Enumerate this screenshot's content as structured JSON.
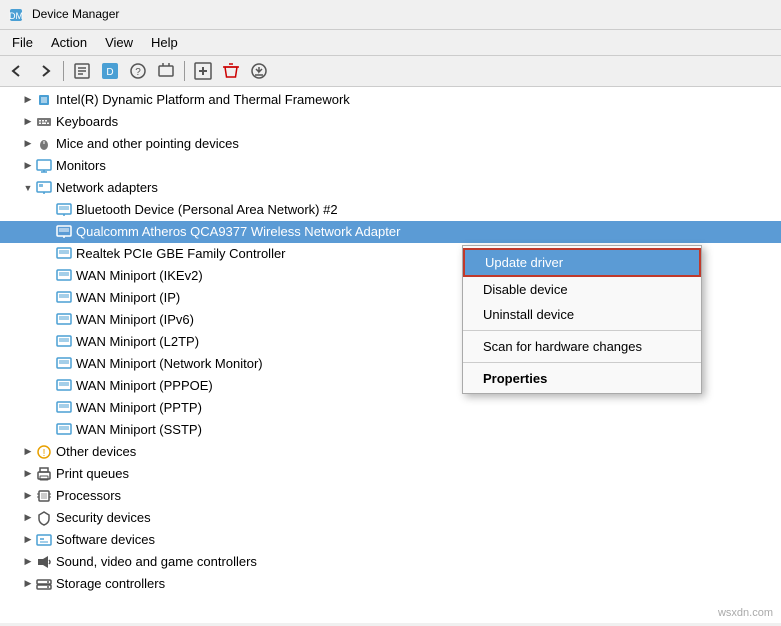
{
  "titleBar": {
    "title": "Device Manager"
  },
  "menuBar": {
    "items": [
      "File",
      "Action",
      "View",
      "Help"
    ]
  },
  "toolbar": {
    "buttons": [
      "back",
      "forward",
      "properties",
      "update-driver",
      "help",
      "scan",
      "add-hardware",
      "remove-driver",
      "download"
    ]
  },
  "tree": {
    "items": [
      {
        "id": "intel",
        "label": "Intel(R) Dynamic Platform and Thermal Framework",
        "indent": 1,
        "icon": "chip",
        "hasToggle": true,
        "expanded": false
      },
      {
        "id": "keyboards",
        "label": "Keyboards",
        "indent": 1,
        "icon": "keyboard",
        "hasToggle": true,
        "expanded": false
      },
      {
        "id": "mice",
        "label": "Mice and other pointing devices",
        "indent": 1,
        "icon": "mouse",
        "hasToggle": true,
        "expanded": false
      },
      {
        "id": "monitors",
        "label": "Monitors",
        "indent": 1,
        "icon": "monitor",
        "hasToggle": true,
        "expanded": false
      },
      {
        "id": "network",
        "label": "Network adapters",
        "indent": 1,
        "icon": "network",
        "hasToggle": true,
        "expanded": true
      },
      {
        "id": "bluetooth",
        "label": "Bluetooth Device (Personal Area Network) #2",
        "indent": 2,
        "icon": "network-adapter",
        "hasToggle": false
      },
      {
        "id": "qualcomm",
        "label": "Qualcomm Atheros QCA9377 Wireless Network Adapter",
        "indent": 2,
        "icon": "network-adapter",
        "hasToggle": false,
        "highlighted": true
      },
      {
        "id": "realtek",
        "label": "Realtek PCIe GBE Family Controller",
        "indent": 2,
        "icon": "network-adapter",
        "hasToggle": false
      },
      {
        "id": "wan-ikev2",
        "label": "WAN Miniport (IKEv2)",
        "indent": 2,
        "icon": "network-adapter",
        "hasToggle": false
      },
      {
        "id": "wan-ip",
        "label": "WAN Miniport (IP)",
        "indent": 2,
        "icon": "network-adapter",
        "hasToggle": false
      },
      {
        "id": "wan-ipv6",
        "label": "WAN Miniport (IPv6)",
        "indent": 2,
        "icon": "network-adapter",
        "hasToggle": false
      },
      {
        "id": "wan-l2tp",
        "label": "WAN Miniport (L2TP)",
        "indent": 2,
        "icon": "network-adapter",
        "hasToggle": false
      },
      {
        "id": "wan-netmon",
        "label": "WAN Miniport (Network Monitor)",
        "indent": 2,
        "icon": "network-adapter",
        "hasToggle": false
      },
      {
        "id": "wan-pppoe",
        "label": "WAN Miniport (PPPOE)",
        "indent": 2,
        "icon": "network-adapter",
        "hasToggle": false
      },
      {
        "id": "wan-pptp",
        "label": "WAN Miniport (PPTP)",
        "indent": 2,
        "icon": "network-adapter",
        "hasToggle": false
      },
      {
        "id": "wan-sstp",
        "label": "WAN Miniport (SSTP)",
        "indent": 2,
        "icon": "network-adapter",
        "hasToggle": false
      },
      {
        "id": "other",
        "label": "Other devices",
        "indent": 1,
        "icon": "other",
        "hasToggle": true,
        "expanded": false
      },
      {
        "id": "print",
        "label": "Print queues",
        "indent": 1,
        "icon": "printer",
        "hasToggle": true,
        "expanded": false
      },
      {
        "id": "processors",
        "label": "Processors",
        "indent": 1,
        "icon": "processor",
        "hasToggle": true,
        "expanded": false
      },
      {
        "id": "security",
        "label": "Security devices",
        "indent": 1,
        "icon": "security",
        "hasToggle": true,
        "expanded": false
      },
      {
        "id": "software",
        "label": "Software devices",
        "indent": 1,
        "icon": "software",
        "hasToggle": true,
        "expanded": false
      },
      {
        "id": "sound",
        "label": "Sound, video and game controllers",
        "indent": 1,
        "icon": "sound",
        "hasToggle": true,
        "expanded": false
      },
      {
        "id": "storage",
        "label": "Storage controllers",
        "indent": 1,
        "icon": "storage",
        "hasToggle": true,
        "expanded": false
      }
    ]
  },
  "contextMenu": {
    "items": [
      {
        "id": "update-driver",
        "label": "Update driver",
        "bold": false,
        "active": true
      },
      {
        "id": "disable-device",
        "label": "Disable device",
        "bold": false
      },
      {
        "id": "uninstall-device",
        "label": "Uninstall device",
        "bold": false
      },
      {
        "id": "sep1",
        "type": "separator"
      },
      {
        "id": "scan-hardware",
        "label": "Scan for hardware changes",
        "bold": false
      },
      {
        "id": "sep2",
        "type": "separator"
      },
      {
        "id": "properties",
        "label": "Properties",
        "bold": true
      }
    ]
  },
  "watermark": "wsxdn.com"
}
